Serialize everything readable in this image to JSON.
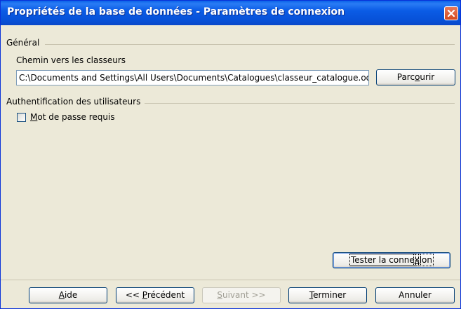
{
  "window": {
    "title": "Propriétés de la base de données - Paramètres de connexion"
  },
  "general": {
    "section_label": "Général",
    "path_label": "Chemin vers les classeurs",
    "path_value": "C:\\Documents and Settings\\All Users\\Documents\\Catalogues\\classeur_catalogue.ods",
    "browse_pre": "Parc",
    "browse_key": "o",
    "browse_post": "urir"
  },
  "auth": {
    "section_label": "Authentification des utilisateurs",
    "password_key": "M",
    "password_rest": "ot de passe requis",
    "password_checked": false
  },
  "test_button": {
    "pre": "Tester la conne",
    "key": "x",
    "post": "ion"
  },
  "footer": {
    "help_key": "A",
    "help_rest": "ide",
    "prev_pre": "<< ",
    "prev_key": "P",
    "prev_rest": "récédent",
    "next_key": "S",
    "next_rest": "uivant >>",
    "finish_key": "T",
    "finish_rest": "erminer",
    "cancel_label": "Annuler"
  },
  "icons": {
    "close": "close-icon"
  }
}
